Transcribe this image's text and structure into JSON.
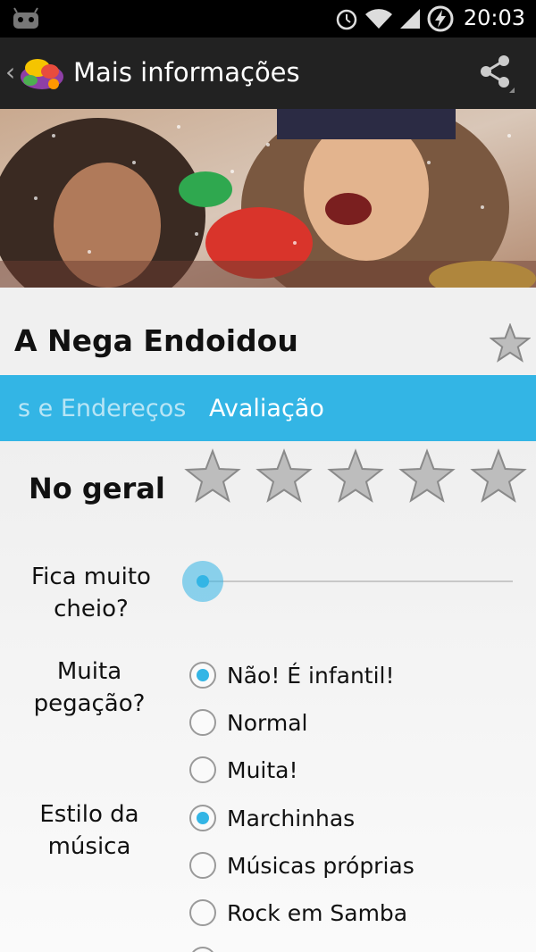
{
  "status_bar": {
    "time": "20:03",
    "icons": [
      "android-robot-icon",
      "alarm-icon",
      "wifi-icon",
      "signal-icon",
      "battery-charging-icon"
    ]
  },
  "action_bar": {
    "title": "Mais informações",
    "icons": [
      "back-chevron-icon",
      "app-logo-icon",
      "share-icon"
    ]
  },
  "place": {
    "name": "A Nega Endoidou"
  },
  "tabs": [
    {
      "label": "s e Endereços"
    },
    {
      "label": "Avaliação"
    }
  ],
  "rating": {
    "overall_label": "No geral",
    "overall_stars": 0,
    "star_max": 5,
    "crowd": {
      "question": "Fica muito cheio?",
      "level": 0
    },
    "flirt": {
      "question": "Muita pegação?",
      "options": [
        "Não! É infantil!",
        "Normal",
        "Muita!"
      ],
      "selected": 0
    },
    "music": {
      "question": "Estilo da música",
      "options": [
        "Marchinhas",
        "Músicas próprias",
        "Rock em Samba"
      ],
      "selected": 0
    }
  },
  "colors": {
    "accent": "#33b5e5",
    "action_bar": "#222222",
    "status_bar": "#000000",
    "star_fill": "#bdbdbd"
  }
}
